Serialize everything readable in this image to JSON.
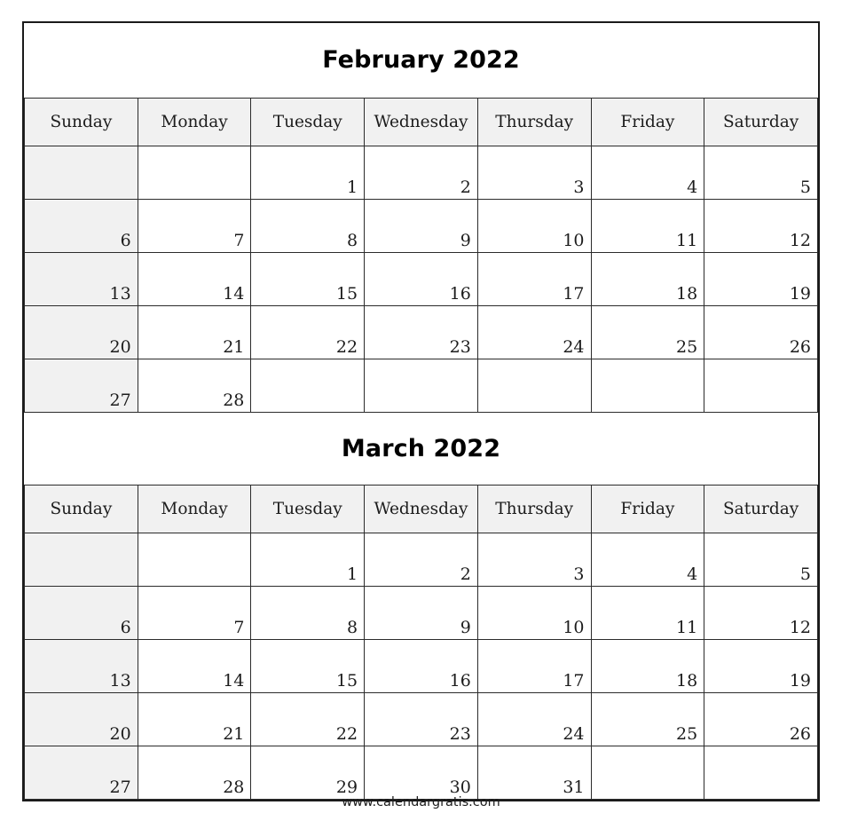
{
  "document": {
    "type": "printable-calendar",
    "year": "2022",
    "footer_url": "www.calendargratis.com"
  },
  "weekday_headers": [
    "Sunday",
    "Monday",
    "Tuesday",
    "Wednesday",
    "Thursday",
    "Friday",
    "Saturday"
  ],
  "months": [
    {
      "title": "February 2022",
      "name": "February",
      "weeks": [
        [
          "",
          "",
          "1",
          "2",
          "3",
          "4",
          "5"
        ],
        [
          "6",
          "7",
          "8",
          "9",
          "10",
          "11",
          "12"
        ],
        [
          "13",
          "14",
          "15",
          "16",
          "17",
          "18",
          "19"
        ],
        [
          "20",
          "21",
          "22",
          "23",
          "24",
          "25",
          "26"
        ],
        [
          "27",
          "28",
          "",
          "",
          "",
          "",
          ""
        ]
      ]
    },
    {
      "title": "March 2022",
      "name": "March",
      "weeks": [
        [
          "",
          "",
          "1",
          "2",
          "3",
          "4",
          "5"
        ],
        [
          "6",
          "7",
          "8",
          "9",
          "10",
          "11",
          "12"
        ],
        [
          "13",
          "14",
          "15",
          "16",
          "17",
          "18",
          "19"
        ],
        [
          "20",
          "21",
          "22",
          "23",
          "24",
          "25",
          "26"
        ],
        [
          "27",
          "28",
          "29",
          "30",
          "31",
          "",
          ""
        ]
      ]
    }
  ],
  "colors": {
    "header_background": "#f1f1f1",
    "sunday_background": "#f1f1f1",
    "cell_background": "#ffffff",
    "border": "#2b2b2b",
    "outer_border": "#1a1a1a",
    "text": "#1c1c1c",
    "title_text": "#000000"
  }
}
